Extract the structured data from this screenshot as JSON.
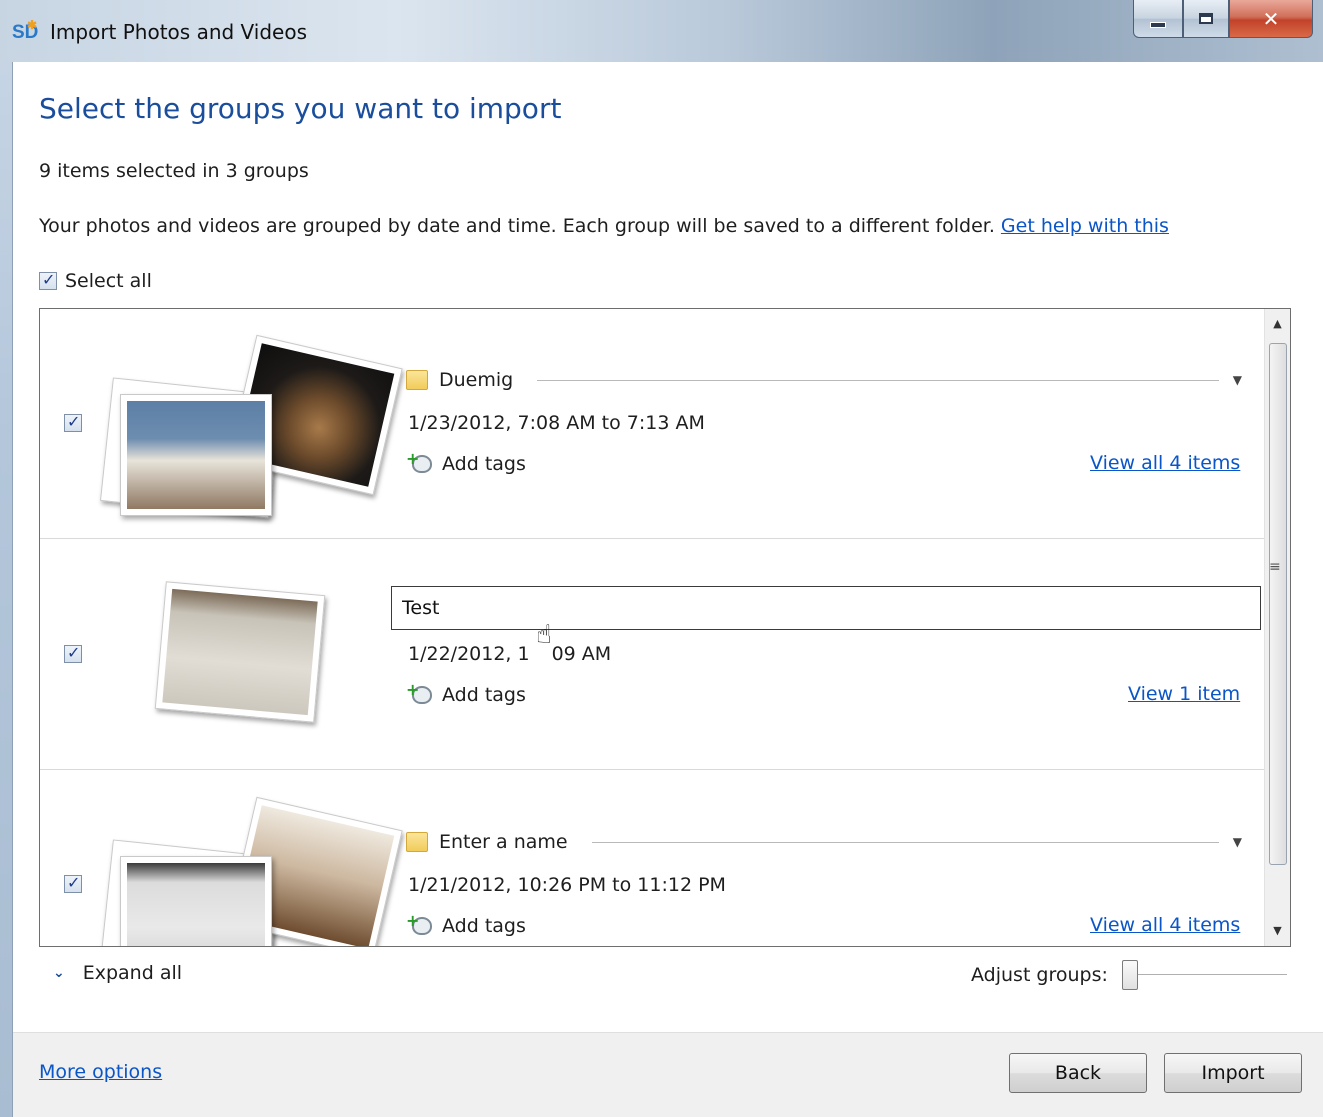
{
  "window": {
    "title": "Import Photos and Videos",
    "app_icon": "SD"
  },
  "heading": "Select the groups you want to import",
  "selection_summary": "9 items selected in 3 groups",
  "description": "Your photos and videos are grouped by date and time. Each group will be saved to a different folder.",
  "help_link": "Get help with this",
  "select_all": {
    "label": "Select all",
    "checked": true
  },
  "groups": [
    {
      "checked": true,
      "name": "Duemig",
      "date": "1/23/2012, 7:08 AM to 7:13 AM",
      "add_tags": "Add tags",
      "view_link": "View all 4 items"
    },
    {
      "checked": true,
      "name_input_value": "Test",
      "date": "1/22/2012, 1",
      "date_rest": "09 AM",
      "add_tags": "Add tags",
      "view_link": "View 1 item"
    },
    {
      "checked": true,
      "name": "Enter a name",
      "date": "1/21/2012, 10:26 PM to 11:12 PM",
      "add_tags": "Add tags",
      "view_link": "View all 4 items"
    }
  ],
  "expand_all": "Expand all",
  "adjust_groups": {
    "label": "Adjust groups:",
    "value": 0
  },
  "footer": {
    "more_options": "More options",
    "back": "Back",
    "import": "Import"
  },
  "icons": {
    "folder": "folder-icon",
    "add_tag": "add-tag-icon",
    "expand": "chevron-down-icon",
    "close": "close-icon",
    "minimize": "minimize-icon",
    "maximize": "maximize-icon"
  },
  "colors": {
    "heading": "#1a4e9c",
    "link": "#0a55c8",
    "close_button": "#c2422a"
  }
}
